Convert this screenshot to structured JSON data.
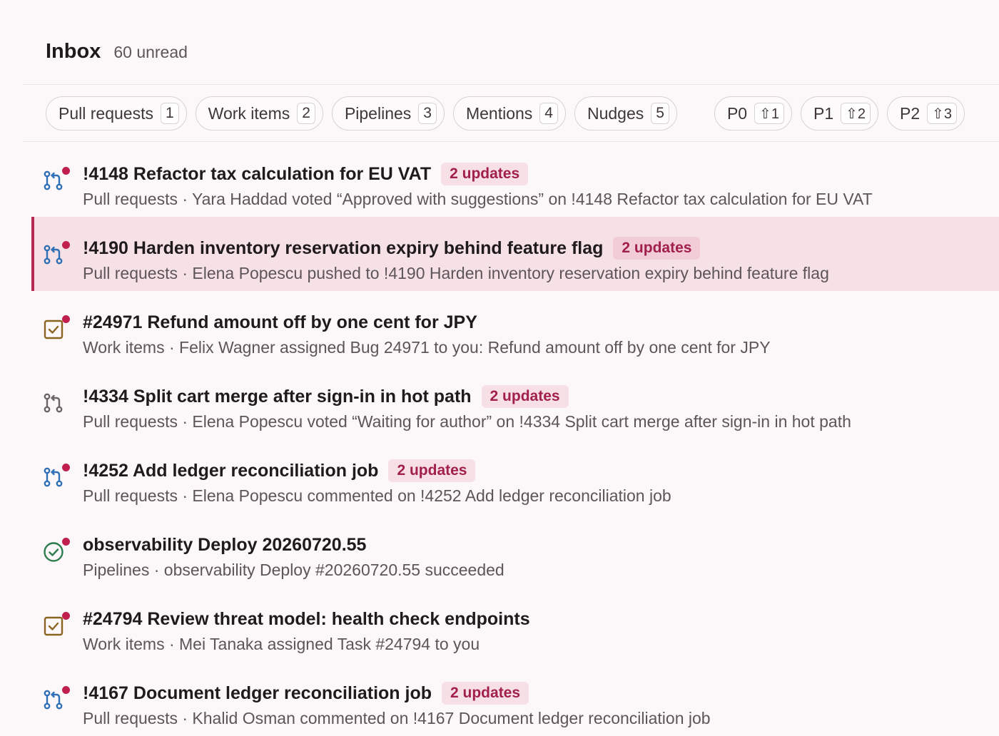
{
  "header": {
    "title": "Inbox",
    "unread": "60 unread"
  },
  "filters": [
    {
      "label": "Pull requests",
      "count": "1"
    },
    {
      "label": "Work items",
      "count": "2"
    },
    {
      "label": "Pipelines",
      "count": "3"
    },
    {
      "label": "Mentions",
      "count": "4"
    },
    {
      "label": "Nudges",
      "count": "5"
    }
  ],
  "priorities": [
    {
      "label": "P0",
      "shortcut": "⇧1"
    },
    {
      "label": "P1",
      "shortcut": "⇧2"
    },
    {
      "label": "P2",
      "shortcut": "⇧3"
    }
  ],
  "items": [
    {
      "icon": "merge-request-icon",
      "unread": true,
      "title": "!4148 Refactor tax calculation for EU VAT",
      "badge": "2 updates",
      "desc": "Pull requests · Yara Haddad voted “Approved with suggestions” on !4148 Refactor tax calculation for EU VAT"
    },
    {
      "icon": "merge-request-icon",
      "unread": true,
      "selected": true,
      "title": "!4190 Harden inventory reservation expiry behind feature flag",
      "badge": "2 updates",
      "desc": "Pull requests · Elena Popescu pushed to !4190 Harden inventory reservation expiry behind feature flag"
    },
    {
      "icon": "work-item-icon",
      "unread": true,
      "title": "#24971 Refund amount off by one cent for JPY",
      "badge": "",
      "desc": "Work items · Felix Wagner assigned Bug 24971 to you: Refund amount off by one cent for JPY"
    },
    {
      "icon": "merge-request-icon",
      "unread": false,
      "title": "!4334 Split cart merge after sign-in in hot path",
      "badge": "2 updates",
      "desc": "Pull requests · Elena Popescu voted “Waiting for author” on !4334 Split cart merge after sign-in in hot path"
    },
    {
      "icon": "merge-request-icon",
      "unread": true,
      "title": "!4252 Add ledger reconciliation job",
      "badge": "2 updates",
      "desc": "Pull requests · Elena Popescu commented on !4252 Add ledger reconciliation job"
    },
    {
      "icon": "pipeline-success-icon",
      "unread": true,
      "title": "observability Deploy 20260720.55",
      "badge": "",
      "desc": "Pipelines · observability Deploy #20260720.55 succeeded"
    },
    {
      "icon": "work-item-icon",
      "unread": true,
      "title": "#24794 Review threat model: health check endpoints",
      "badge": "",
      "desc": "Work items · Mei Tanaka assigned Task #24794 to you"
    },
    {
      "icon": "merge-request-icon",
      "unread": true,
      "title": "!4167 Document ledger reconciliation job",
      "badge": "2 updates",
      "desc": "Pull requests · Khalid Osman commented on !4167 Document ledger reconciliation job"
    }
  ],
  "colors": {
    "accent": "#b72a55",
    "unread_dot": "#c1204f",
    "pr_icon": "#2f6fb5",
    "pr_icon_read": "#6b6568",
    "work_item_icon": "#8a6420",
    "pipeline_success": "#2e7d4f",
    "selected_row_bg": "#f5e1e6"
  }
}
